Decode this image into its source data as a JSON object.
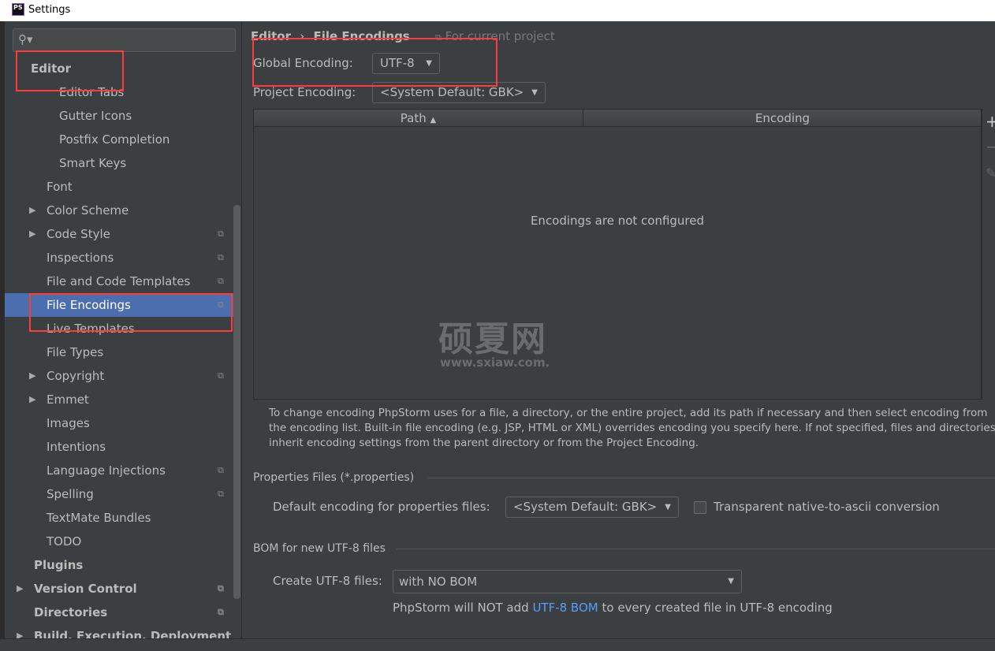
{
  "window": {
    "title": "Settings",
    "app_icon": "PS"
  },
  "sidebar": {
    "search_placeholder": "",
    "items": [
      {
        "label": "Editor",
        "level": 0,
        "bold": true
      },
      {
        "label": "Editor Tabs",
        "level": 2
      },
      {
        "label": "Gutter Icons",
        "level": 2
      },
      {
        "label": "Postfix Completion",
        "level": 2
      },
      {
        "label": "Smart Keys",
        "level": 2
      },
      {
        "label": "Font",
        "level": 1
      },
      {
        "label": "Color Scheme",
        "level": 1,
        "expandable": true
      },
      {
        "label": "Code Style",
        "level": 1,
        "expandable": true,
        "project": true
      },
      {
        "label": "Inspections",
        "level": 1,
        "project": true
      },
      {
        "label": "File and Code Templates",
        "level": 1,
        "project": true
      },
      {
        "label": "File Encodings",
        "level": 1,
        "project": true,
        "selected": true
      },
      {
        "label": "Live Templates",
        "level": 1
      },
      {
        "label": "File Types",
        "level": 1
      },
      {
        "label": "Copyright",
        "level": 1,
        "expandable": true,
        "project": true
      },
      {
        "label": "Emmet",
        "level": 1,
        "expandable": true
      },
      {
        "label": "Images",
        "level": 1
      },
      {
        "label": "Intentions",
        "level": 1
      },
      {
        "label": "Language Injections",
        "level": 1,
        "project": true
      },
      {
        "label": "Spelling",
        "level": 1,
        "project": true
      },
      {
        "label": "TextMate Bundles",
        "level": 1
      },
      {
        "label": "TODO",
        "level": 1
      },
      {
        "label": "Plugins",
        "level": 0,
        "bold": true
      },
      {
        "label": "Version Control",
        "level": 0,
        "bold": true,
        "expandable": true,
        "project": true
      },
      {
        "label": "Directories",
        "level": 0,
        "bold": true,
        "project": true
      },
      {
        "label": "Build, Execution, Deployment",
        "level": 0,
        "bold": true,
        "expandable": true
      }
    ]
  },
  "main": {
    "breadcrumb": {
      "parent": "Editor",
      "sep": "›",
      "current": "File Encodings",
      "scope": "For current project"
    },
    "global_encoding": {
      "label": "Global Encoding:",
      "value": "UTF-8"
    },
    "project_encoding": {
      "label": "Project Encoding:",
      "value": "<System Default: GBK>"
    },
    "table": {
      "columns": [
        "Path",
        "Encoding"
      ],
      "sort": "Path ascending",
      "empty_text": "Encodings are not configured"
    },
    "help_text": "To change encoding PhpStorm uses for a file, a directory, or the entire project, add its path if necessary and then select encoding from the encoding list. Built-in file encoding (e.g. JSP, HTML or XML) overrides encoding you specify here. If not specified, files and directories inherit encoding settings from the parent directory or from the Project Encoding.",
    "properties": {
      "section": "Properties Files (*.properties)",
      "label": "Default encoding for properties files:",
      "value": "<System Default: GBK>",
      "checkbox_label": "Transparent native-to-ascii conversion",
      "checked": false
    },
    "bom": {
      "section": "BOM for new UTF-8 files",
      "label": "Create UTF-8 files:",
      "value": "with NO BOM",
      "note_before": "PhpStorm will NOT add ",
      "note_link": "UTF-8 BOM",
      "note_after": " to every created file in UTF-8 encoding"
    }
  },
  "watermark": {
    "title": "硕夏网",
    "url": "www.sxiaw.com."
  },
  "colors": {
    "selection": "#4b6eaf",
    "link": "#589df6",
    "annotation": "#ff3b3b",
    "background": "#3c3f41"
  }
}
